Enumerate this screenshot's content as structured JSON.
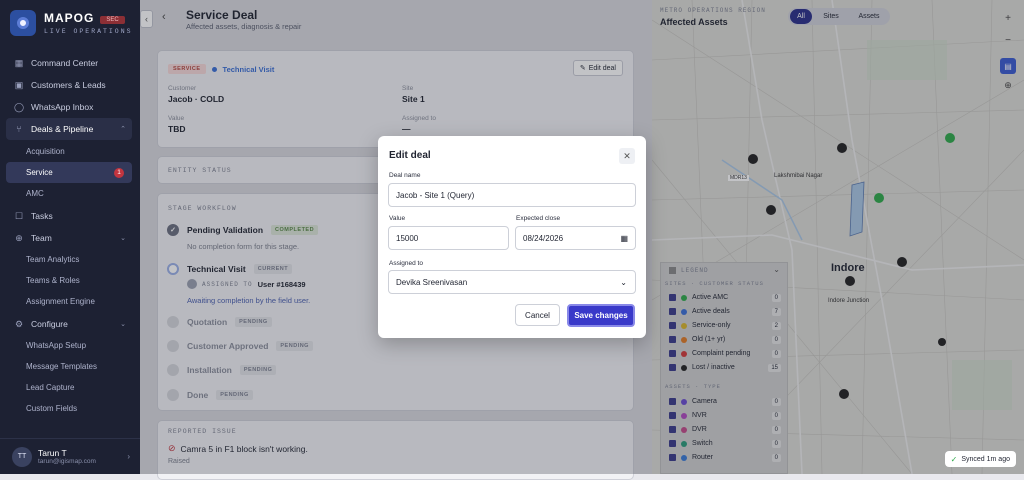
{
  "brand": {
    "name": "MAPOG",
    "tag": "SEC",
    "subtitle": "LIVE OPERATIONS"
  },
  "nav": {
    "items": [
      {
        "label": "Command Center",
        "icon": "grid-icon"
      },
      {
        "label": "Customers & Leads",
        "icon": "users-icon"
      },
      {
        "label": "WhatsApp Inbox",
        "icon": "whatsapp-icon"
      },
      {
        "label": "Deals & Pipeline",
        "icon": "pipeline-icon"
      }
    ],
    "deals_sub": [
      "Acquisition",
      "Service",
      "AMC"
    ],
    "service_badge": "1",
    "tasks": "Tasks",
    "team": "Team",
    "team_sub": [
      "Team Analytics",
      "Teams & Roles",
      "Assignment Engine"
    ],
    "configure": "Configure",
    "configure_sub": [
      "WhatsApp Setup",
      "Message Templates",
      "Lead Capture",
      "Custom Fields"
    ]
  },
  "user": {
    "initials": "TT",
    "name": "Tarun T",
    "email": "tarun@igismap.com"
  },
  "header": {
    "title": "Service Deal",
    "subtitle": "Affected assets, diagnosis & repair"
  },
  "deal": {
    "type_tag": "SERVICE",
    "stage_tag": "Technical Visit",
    "edit_label": "Edit deal",
    "customer_label": "Customer",
    "customer": "Jacob · COLD",
    "site_label": "Site",
    "site": "Site 1",
    "value_label": "Value",
    "value": "TBD",
    "assigned_label": "Assigned to",
    "assigned": "—"
  },
  "entity_status": "ENTITY STATUS",
  "workflow": {
    "title": "STAGE WORKFLOW",
    "steps": [
      {
        "name": "Pending Validation",
        "pill": "COMPLETED",
        "note": "No completion form for this stage."
      },
      {
        "name": "Technical Visit",
        "pill": "CURRENT",
        "assigned_prefix": "ASSIGNED TO",
        "assigned_user": "User #168439",
        "note": "Awaiting completion by the field user."
      },
      {
        "name": "Quotation",
        "pill": "PENDING"
      },
      {
        "name": "Customer Approved",
        "pill": "PENDING"
      },
      {
        "name": "Installation",
        "pill": "PENDING"
      },
      {
        "name": "Done",
        "pill": "PENDING"
      }
    ]
  },
  "issue": {
    "title": "REPORTED ISSUE",
    "text": "Camra 5 in F1 block isn't working.",
    "status": "Raised"
  },
  "modal": {
    "title": "Edit deal",
    "deal_name_label": "Deal name",
    "deal_name": "Jacob - Site 1 (Query)",
    "value_label": "Value",
    "value": "15000",
    "close_label": "Expected close",
    "close_date": "08/24/2026",
    "assigned_label": "Assigned to",
    "assigned": "Devika Sreenivasan",
    "cancel": "Cancel",
    "save": "Save changes"
  },
  "map": {
    "overline": "METRO OPERATIONS REGION",
    "title": "Affected Assets",
    "filters": [
      "All",
      "Sites",
      "Assets"
    ],
    "labels": [
      "Lakshmibai Nagar",
      "Indore",
      "Indore Junction",
      "MDR13"
    ],
    "legend_title": "LEGEND",
    "sites_title": "SITES · CUSTOMER STATUS",
    "sites": [
      {
        "label": "Active AMC",
        "count": "0",
        "color": "#2faa4a"
      },
      {
        "label": "Active deals",
        "count": "7",
        "color": "#3b6fd6"
      },
      {
        "label": "Service-only",
        "count": "2",
        "color": "#d8b42a"
      },
      {
        "label": "Old (1+ yr)",
        "count": "0",
        "color": "#e07a25"
      },
      {
        "label": "Complaint pending",
        "count": "0",
        "color": "#d23a3a"
      },
      {
        "label": "Lost / inactive",
        "count": "15",
        "color": "#222222"
      }
    ],
    "assets_title": "ASSETS · TYPE",
    "assets": [
      {
        "label": "Camera",
        "count": "0",
        "color": "#6a4bd0"
      },
      {
        "label": "NVR",
        "count": "0",
        "color": "#b04ac0"
      },
      {
        "label": "DVR",
        "count": "0",
        "color": "#c24a8a"
      },
      {
        "label": "Switch",
        "count": "0",
        "color": "#2a9a7a"
      },
      {
        "label": "Router",
        "count": "0",
        "color": "#3a7ad6"
      }
    ],
    "synced": "Synced 1m ago"
  }
}
